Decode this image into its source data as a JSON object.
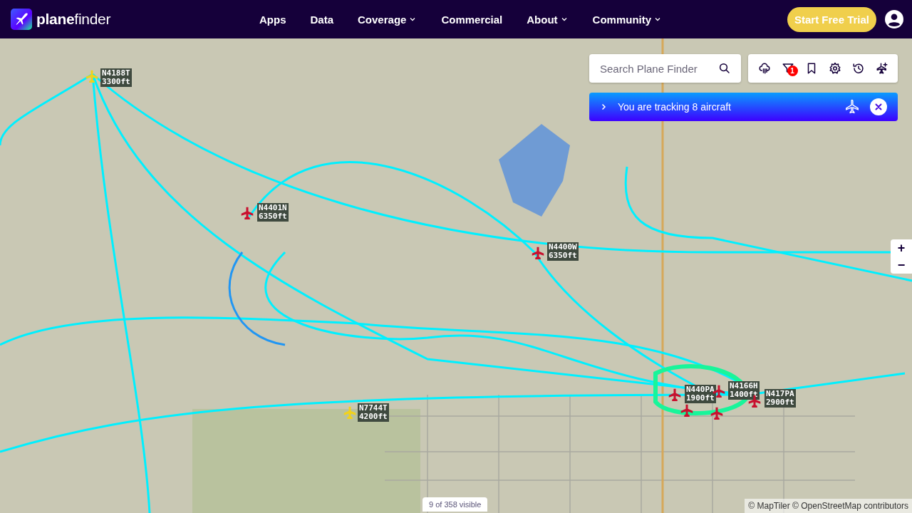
{
  "header": {
    "logo": "**plane**finder",
    "nav": [
      {
        "label": "Apps",
        "dropdown": false
      },
      {
        "label": "Data",
        "dropdown": false
      },
      {
        "label": "Coverage",
        "dropdown": true
      },
      {
        "label": "Commercial",
        "dropdown": false
      },
      {
        "label": "About",
        "dropdown": true
      },
      {
        "label": "Community",
        "dropdown": true
      }
    ],
    "cta": "Start Free Trial"
  },
  "search": {
    "placeholder": "Search Plane Finder"
  },
  "toolbar": {
    "filter_badge": "1"
  },
  "tracking_banner": {
    "text": "You are tracking 8 aircraft"
  },
  "zoom": {
    "in": "+",
    "out": "−"
  },
  "aircraft": [
    {
      "callsign": "N4188T",
      "altitude": "3300ft",
      "color": "#f2d21b"
    },
    {
      "callsign": "N4401N",
      "altitude": "6350ft",
      "color": "#c8102e"
    },
    {
      "callsign": "N4400W",
      "altitude": "6350ft",
      "color": "#c8102e"
    },
    {
      "callsign": "N7744T",
      "altitude": "4200ft",
      "color": "#f2d21b"
    },
    {
      "callsign": "N440PA",
      "altitude": "1900ft",
      "color": "#c8102e"
    },
    {
      "callsign": "N4166H",
      "altitude": "1400ft",
      "color": "#c8102e"
    },
    {
      "callsign": "N417PA",
      "altitude": "2900ft",
      "color": "#c8102e"
    }
  ],
  "unlabeled_aircraft": [
    {
      "color": "#c8102e"
    },
    {
      "color": "#c8102e"
    }
  ],
  "visible_count": "9 of 358 visible",
  "attribution": "© MapTiler © OpenStreetMap contributors"
}
